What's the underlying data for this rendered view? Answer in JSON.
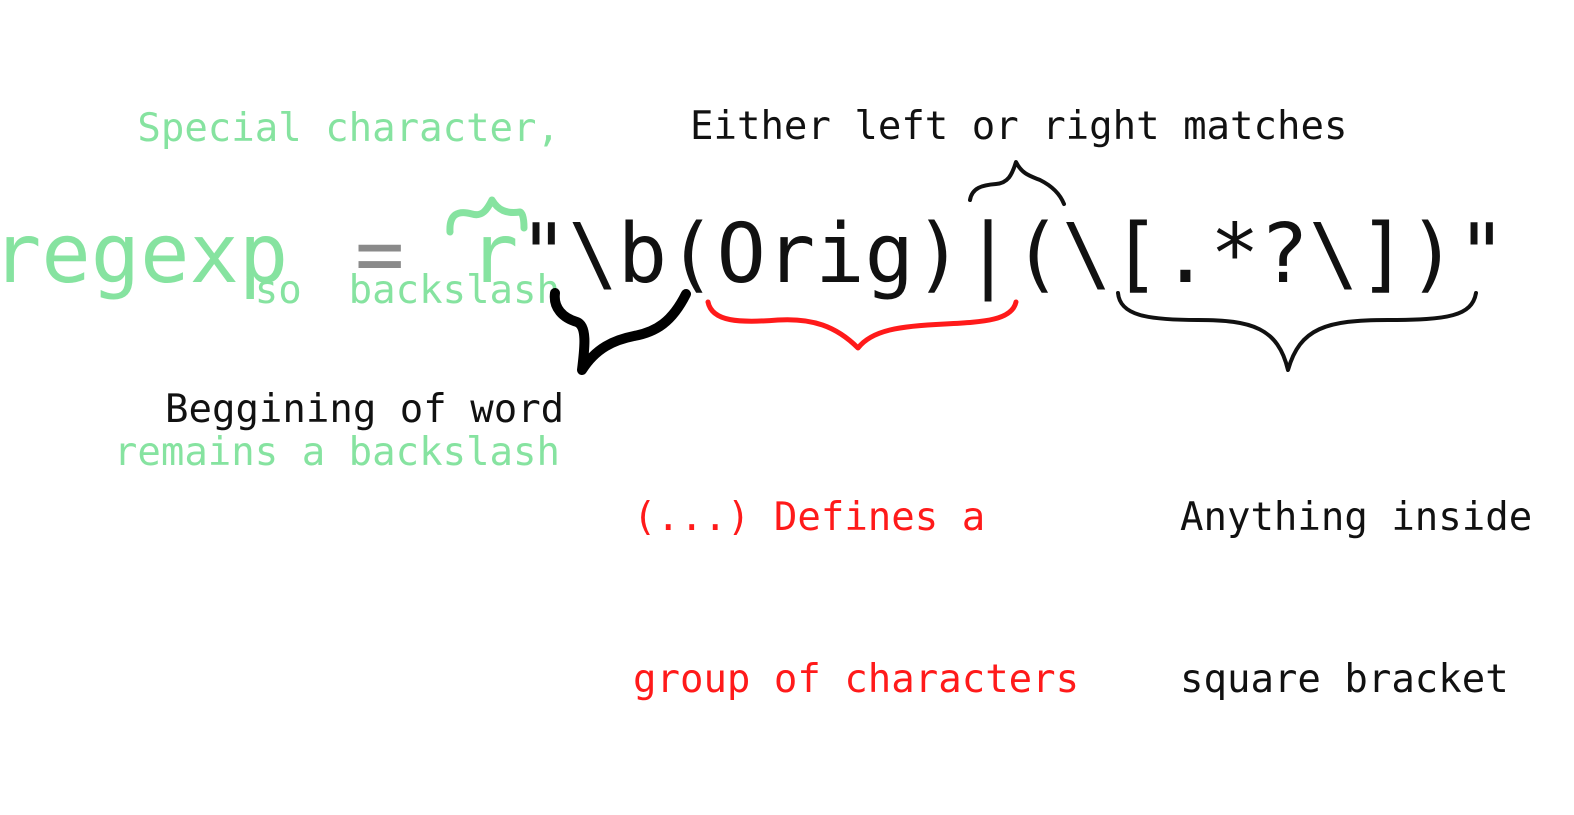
{
  "notes": {
    "special_character": [
      "Special character,",
      "so  backslash",
      "remains a backslash"
    ],
    "either_left_or_right": "Either left or right matches",
    "beginning_of_word": "Beggining of word",
    "group_definition": [
      "(...) Defines a",
      "group of characters"
    ],
    "anything_inside": [
      "Anything inside",
      "square bracket"
    ]
  },
  "code": {
    "variable": "regexp",
    "operator": "=",
    "prefix": "r",
    "pattern": "\"\\b(Orig)|(\\[.*?\\])\""
  },
  "colors": {
    "raw_annotation": "#86e3a0",
    "group_annotation": "#ff1a1a",
    "text": "#111111",
    "operator": "#8a8a8a"
  }
}
